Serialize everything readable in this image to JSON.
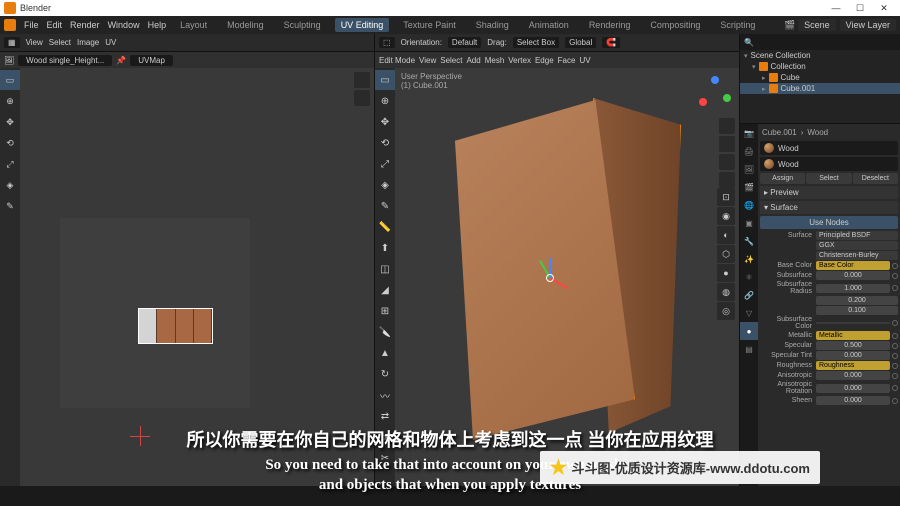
{
  "titlebar": {
    "app": "Blender"
  },
  "menu": {
    "file": "File",
    "edit": "Edit",
    "render": "Render",
    "window": "Window",
    "help": "Help",
    "tabs": [
      "Layout",
      "Modeling",
      "Sculpting",
      "UV Editing",
      "Texture Paint",
      "Shading",
      "Animation",
      "Rendering",
      "Compositing",
      "Scripting"
    ],
    "active_tab": "UV Editing",
    "scene": "Scene",
    "viewlayer": "View Layer"
  },
  "uv": {
    "header": {
      "sync": "",
      "view": "View",
      "select": "Select",
      "image": "Image",
      "uv": "UV"
    },
    "image_name": "Wood single_Height...",
    "uvmap": "UVMap"
  },
  "v3d": {
    "header": {
      "orientation": "Orientation:",
      "default": "Default",
      "drag": "Drag:",
      "selectbox": "Select Box",
      "global": "Global"
    },
    "mode": "Edit Mode",
    "menus": {
      "view": "View",
      "select": "Select",
      "add": "Add",
      "mesh": "Mesh",
      "vertex": "Vertex",
      "edge": "Edge",
      "face": "Face",
      "uv": "UV"
    },
    "info_line1": "User Perspective",
    "info_line2": "(1) Cube.001"
  },
  "outliner": {
    "title": "Scene Collection",
    "items": [
      {
        "label": "Collection",
        "indent": 1
      },
      {
        "label": "Cube",
        "indent": 2
      },
      {
        "label": "Cube.001",
        "indent": 2,
        "selected": true
      }
    ]
  },
  "props": {
    "crumb_obj": "Cube.001",
    "crumb_mat": "Wood",
    "material": "Wood",
    "btns": {
      "assign": "Assign",
      "select": "Select",
      "deselect": "Deselect"
    },
    "sections": {
      "preview": "Preview",
      "surface": "Surface"
    },
    "use_nodes": "Use Nodes",
    "surface_label": "Surface",
    "surface_val": "Principled BSDF",
    "dist_val": "GGX",
    "sss_method": "Christensen-Burley",
    "basecolor_lbl": "Base Color",
    "basecolor_val": "Base Color",
    "subsurface_lbl": "Subsurface",
    "subsurface_val": "0.000",
    "sss_radius_lbl": "Subsurface Radius",
    "sss_r1": "1.000",
    "sss_r2": "0.200",
    "sss_r3": "0.100",
    "sss_color_lbl": "Subsurface Color",
    "metallic_lbl": "Metallic",
    "metallic_val": "Metallic",
    "specular_lbl": "Specular",
    "specular_val": "0.500",
    "spectint_lbl": "Specular Tint",
    "spectint_val": "0.000",
    "roughness_lbl": "Roughness",
    "roughness_val": "Roughness",
    "aniso_lbl": "Anisotropic",
    "aniso_val": "0.000",
    "anisorot_lbl": "Anisotropic Rotation",
    "anisorot_val": "0.000",
    "sheen_lbl": "Sheen",
    "sheen_val": "0.000"
  },
  "subtitles": {
    "cn": "所以你需要在你自己的网格和物体上考虑到这一点 当你在应用纹理",
    "en1": "So you need to take that into account on your own meshes",
    "en2": "and objects that when you apply textures"
  },
  "watermark": "斗斗图-优质设计资源库-www.ddotu.com"
}
